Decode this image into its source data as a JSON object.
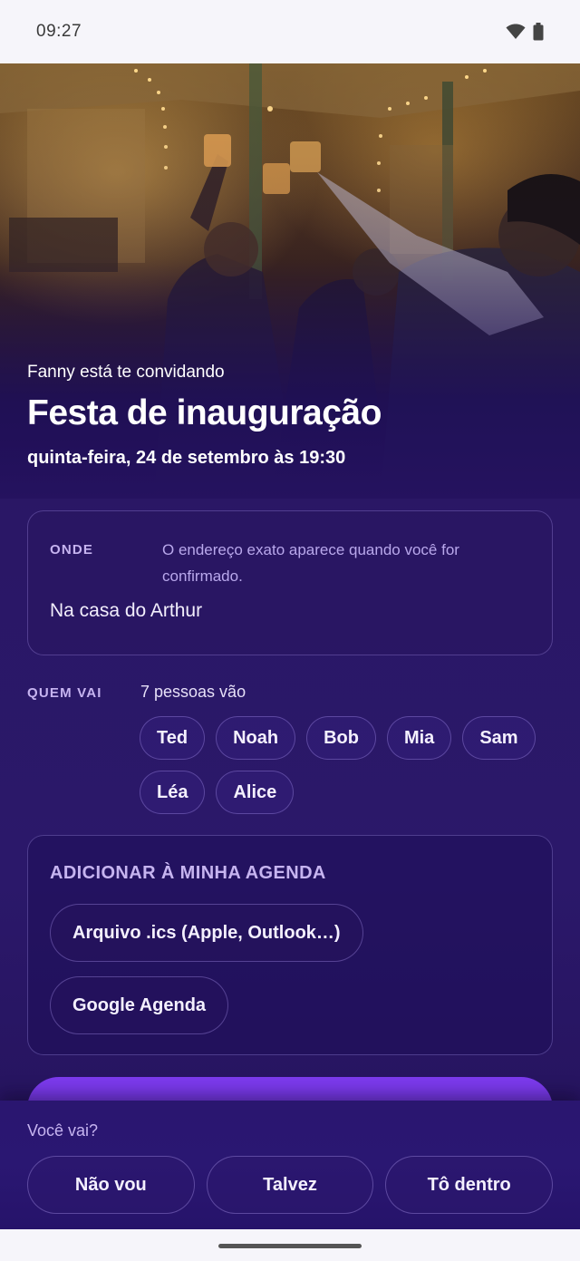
{
  "status_bar": {
    "time": "09:27",
    "icons": [
      "wifi-icon",
      "battery-icon"
    ]
  },
  "hero": {
    "inviter_text": "Fanny está te convidando",
    "title": "Festa de inauguração",
    "datetime": "quinta-feira, 24 de setembro às 19:30"
  },
  "where": {
    "label": "ONDE",
    "note": "O endereço exato aparece quando você for confirmado.",
    "place": "Na casa do Arthur"
  },
  "who": {
    "label": "QUEM VAI",
    "count_text": "7 pessoas vão",
    "guests": [
      "Ted",
      "Noah",
      "Bob",
      "Mia",
      "Sam",
      "Léa",
      "Alice"
    ]
  },
  "calendar": {
    "title": "ADICIONAR À MINHA AGENDA",
    "ics_label": "Arquivo .ics (Apple, Outlook…)",
    "google_label": "Google Agenda"
  },
  "rsvp": {
    "question": "Você vai?",
    "options": [
      "Não vou",
      "Talvez",
      "Tô dentro"
    ]
  },
  "colors": {
    "accent": "#7c3aed",
    "background": "#2a1766",
    "label": "#c6b4f0"
  }
}
